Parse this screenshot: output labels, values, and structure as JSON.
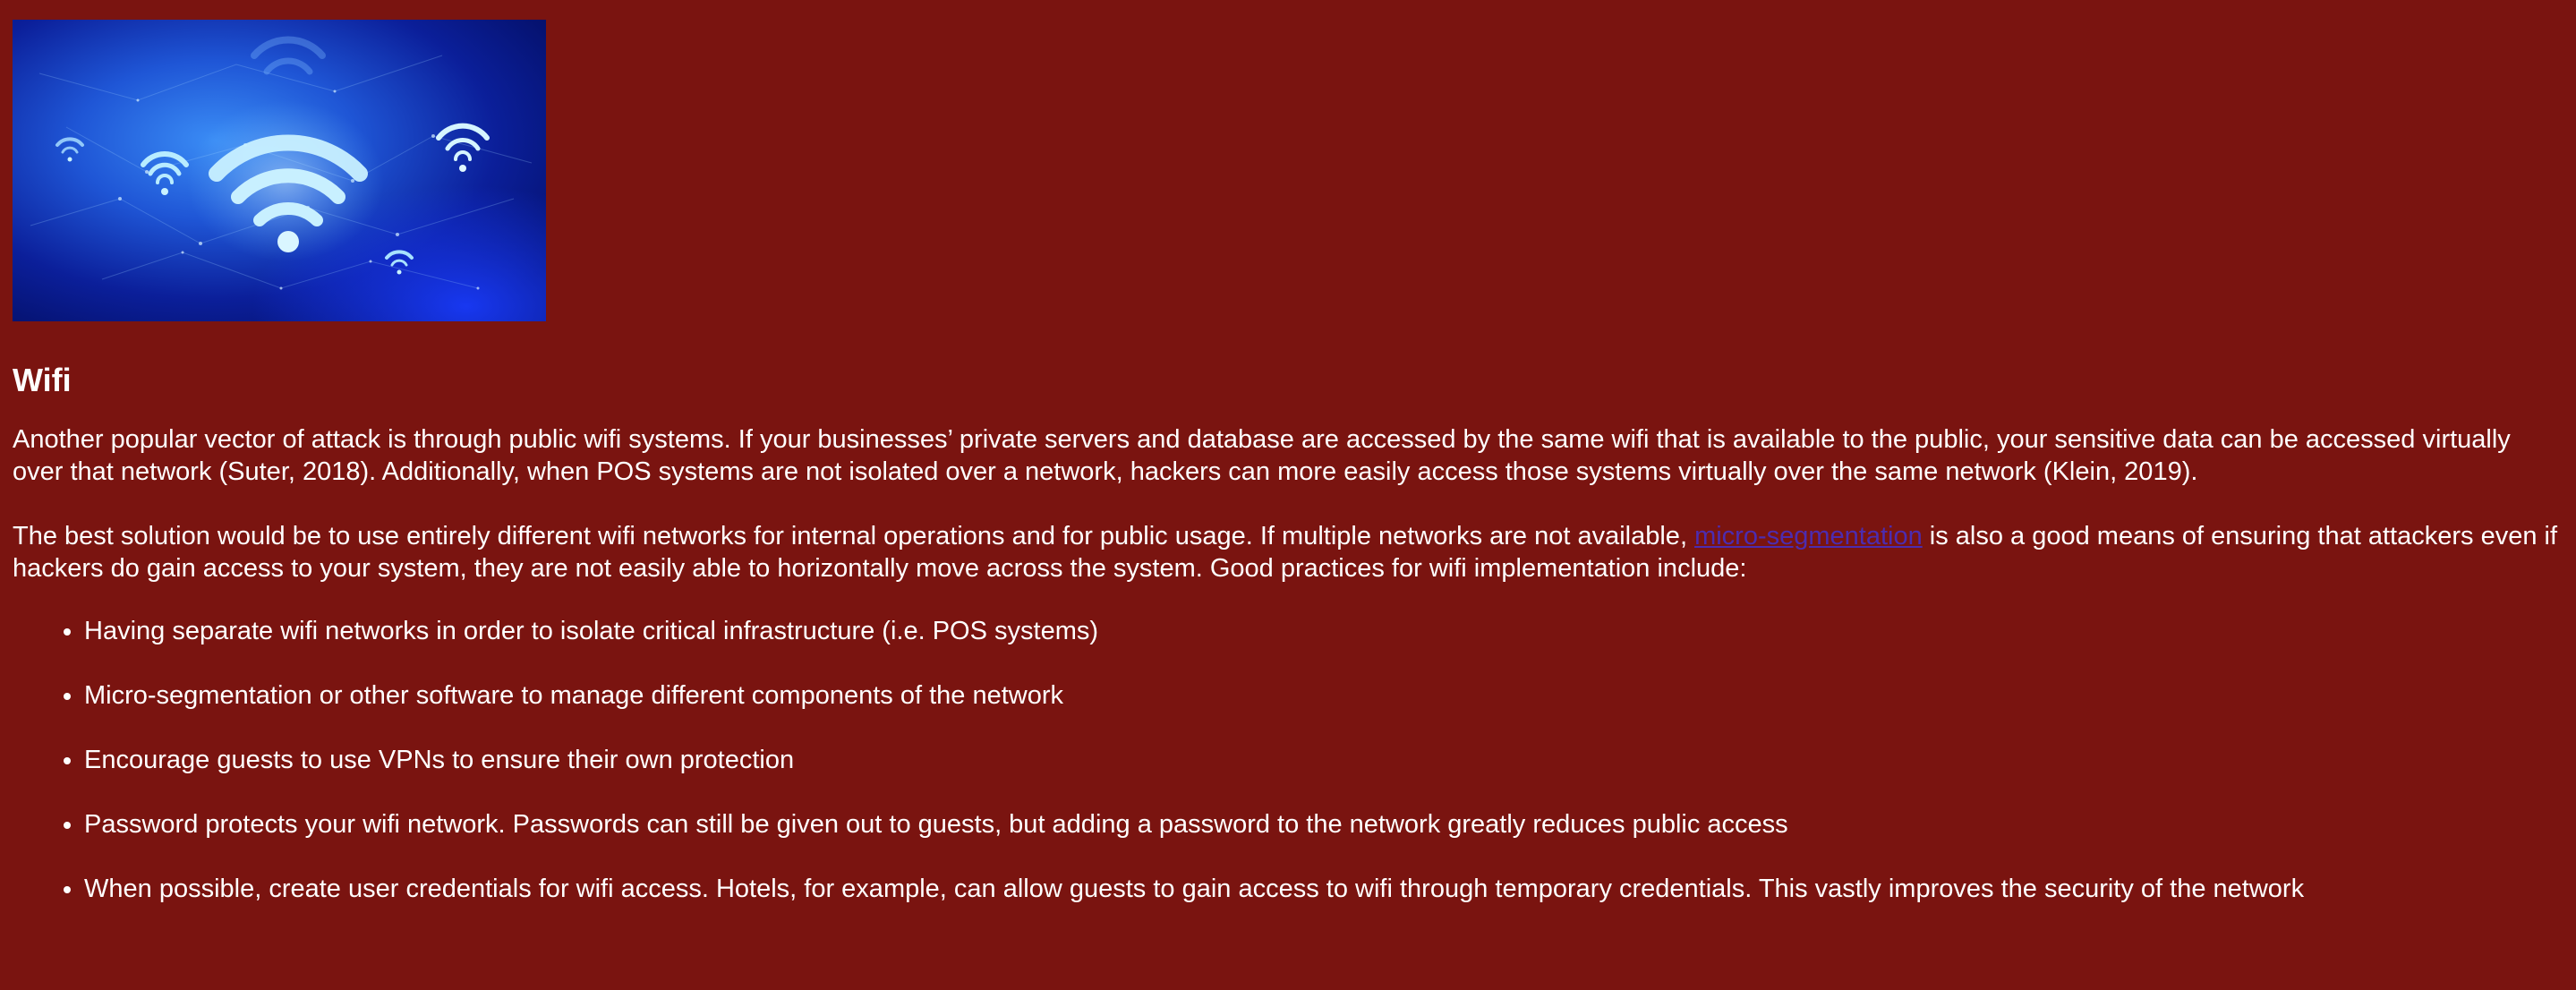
{
  "colors": {
    "background": "#7a1410",
    "text": "#ffffff",
    "link": "#4c2cb0",
    "image_deep_blue": "#06127a",
    "image_bright_blue": "#2d7cf0",
    "image_glow": "#bfe8ff"
  },
  "hero_image": {
    "icon": "wifi-network-illustration"
  },
  "heading": "Wifi",
  "paragraph1": "Another popular vector of attack is through public wifi systems. If your businesses’ private servers and database are accessed by the same wifi that is available to the public, your sensitive data can be accessed virtually over that network (Suter, 2018). Additionally, when POS systems are not isolated over a network, hackers can more easily access those systems virtually over the same network (Klein, 2019).",
  "paragraph2": {
    "before_link": "The best solution would be to use entirely different wifi networks for internal operations and for public usage. If multiple networks are not available, ",
    "link_text": "micro-segmentation",
    "after_link": " is also a good means of ensuring that attackers even if hackers do gain access to your system, they are not easily able to horizontally move across the system. Good practices for wifi implementation include:"
  },
  "practices": [
    "Having separate wifi networks in order to isolate critical infrastructure (i.e. POS systems)",
    "Micro-segmentation or other software to manage different components of the network",
    "Encourage guests to use VPNs to ensure their own protection",
    "Password protects your wifi network. Passwords can still be given out to guests, but adding a password to the network greatly reduces public access",
    "When possible, create user credentials for wifi access. Hotels, for example, can allow guests to gain access to wifi through temporary credentials. This vastly improves the security of the network"
  ]
}
